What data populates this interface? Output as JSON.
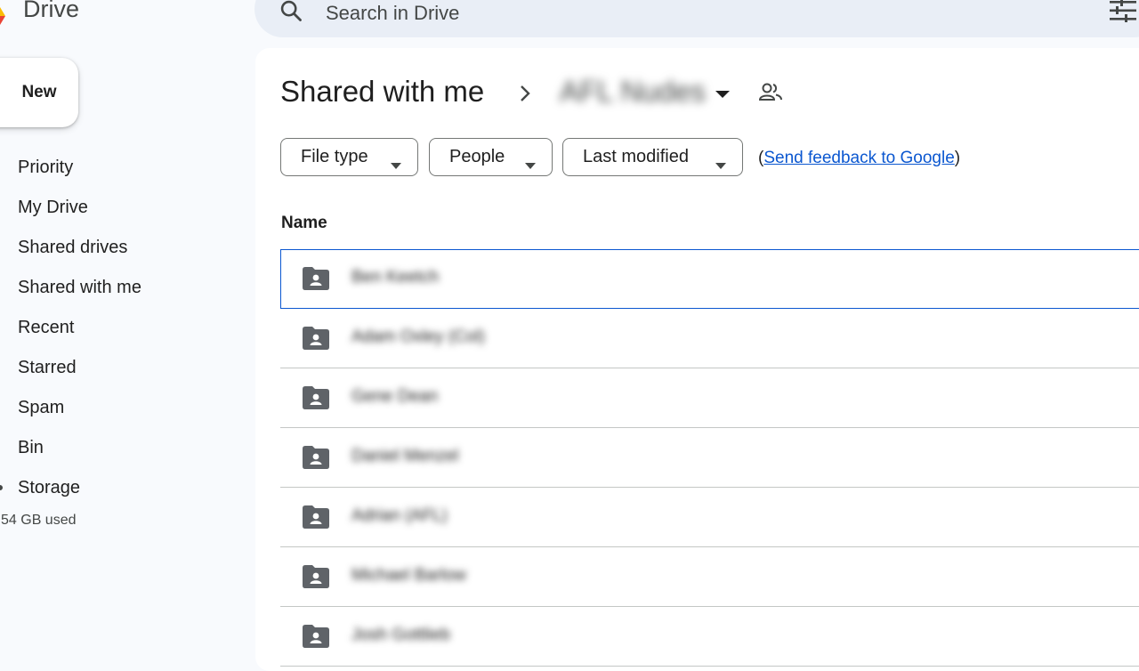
{
  "header": {
    "app_name": "Drive",
    "search_placeholder": "Search in Drive"
  },
  "sidebar": {
    "new_label": "New",
    "items": [
      {
        "label": "Priority"
      },
      {
        "label": "My Drive"
      },
      {
        "label": "Shared drives"
      },
      {
        "label": "Shared with me"
      },
      {
        "label": "Recent"
      },
      {
        "label": "Starred"
      },
      {
        "label": "Spam"
      },
      {
        "label": "Bin"
      },
      {
        "label": "Storage"
      }
    ],
    "storage_used": "54 GB used"
  },
  "breadcrumb": {
    "root": "Shared with me",
    "current_folder": "AFL Nudes"
  },
  "filters": {
    "file_type": "File type",
    "people": "People",
    "last_modified": "Last modified",
    "feedback_open": "(",
    "feedback_link": "Send feedback to Google",
    "feedback_close": ")"
  },
  "table": {
    "column_name": "Name",
    "rows": [
      {
        "name": "Ben Keetch"
      },
      {
        "name": "Adam Oxley (Col)"
      },
      {
        "name": "Gene Dean"
      },
      {
        "name": "Daniel Menzel"
      },
      {
        "name": "Adrian (AFL)"
      },
      {
        "name": "Michael Barlow"
      },
      {
        "name": "Josh Gottlieb"
      }
    ]
  },
  "colors": {
    "accent": "#0b57d0",
    "surface": "#ffffff",
    "background": "#f8fafd",
    "search_bg": "#e9eef6"
  }
}
